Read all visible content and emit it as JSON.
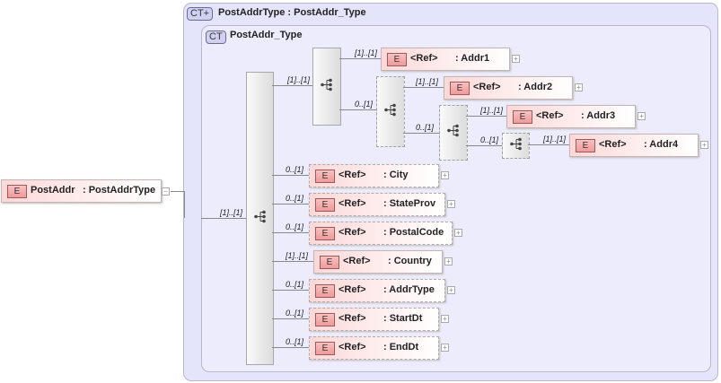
{
  "root_element": {
    "badge": "E",
    "name": "PostAddr",
    "type": ": PostAddrType",
    "collapse": "−"
  },
  "complex_type_outer": {
    "badge": "CT+",
    "title": "PostAddrType : PostAddr_Type"
  },
  "complex_type_inner": {
    "badge": "CT",
    "title": "PostAddr_Type"
  },
  "main_sequence_cardinality": "[1]..[1]",
  "nested_sequences": [
    {
      "cardinality": "[1]..[1]",
      "optional": false
    },
    {
      "cardinality": "0..[1]",
      "optional": true
    },
    {
      "cardinality": "0..[1]",
      "optional": true
    },
    {
      "cardinality": "0..[1]",
      "optional": true
    }
  ],
  "elements": [
    {
      "badge": "E",
      "ref": "<Ref>",
      "name": ": Addr1",
      "cardinality": "[1]..[1]",
      "optional": false,
      "expand": "+"
    },
    {
      "badge": "E",
      "ref": "<Ref>",
      "name": ": Addr2",
      "cardinality": "[1]..[1]",
      "optional": false,
      "expand": "+"
    },
    {
      "badge": "E",
      "ref": "<Ref>",
      "name": ": Addr3",
      "cardinality": "[1]..[1]",
      "optional": false,
      "expand": "+"
    },
    {
      "badge": "E",
      "ref": "<Ref>",
      "name": ": Addr4",
      "cardinality": "[1]..[1]",
      "optional": false,
      "expand": "+"
    },
    {
      "badge": "E",
      "ref": "<Ref>",
      "name": ": City",
      "cardinality": "0..[1]",
      "optional": true,
      "expand": "+"
    },
    {
      "badge": "E",
      "ref": "<Ref>",
      "name": ": StateProv",
      "cardinality": "0..[1]",
      "optional": true,
      "expand": "+"
    },
    {
      "badge": "E",
      "ref": "<Ref>",
      "name": ": PostalCode",
      "cardinality": "0..[1]",
      "optional": true,
      "expand": "+"
    },
    {
      "badge": "E",
      "ref": "<Ref>",
      "name": ": Country",
      "cardinality": "[1]..[1]",
      "optional": false,
      "expand": "+"
    },
    {
      "badge": "E",
      "ref": "<Ref>",
      "name": ": AddrType",
      "cardinality": "0..[1]",
      "optional": true,
      "expand": "+"
    },
    {
      "badge": "E",
      "ref": "<Ref>",
      "name": ": StartDt",
      "cardinality": "0..[1]",
      "optional": true,
      "expand": "+"
    },
    {
      "badge": "E",
      "ref": "<Ref>",
      "name": ": EndDt",
      "cardinality": "0..[1]",
      "optional": true,
      "expand": "+"
    }
  ]
}
